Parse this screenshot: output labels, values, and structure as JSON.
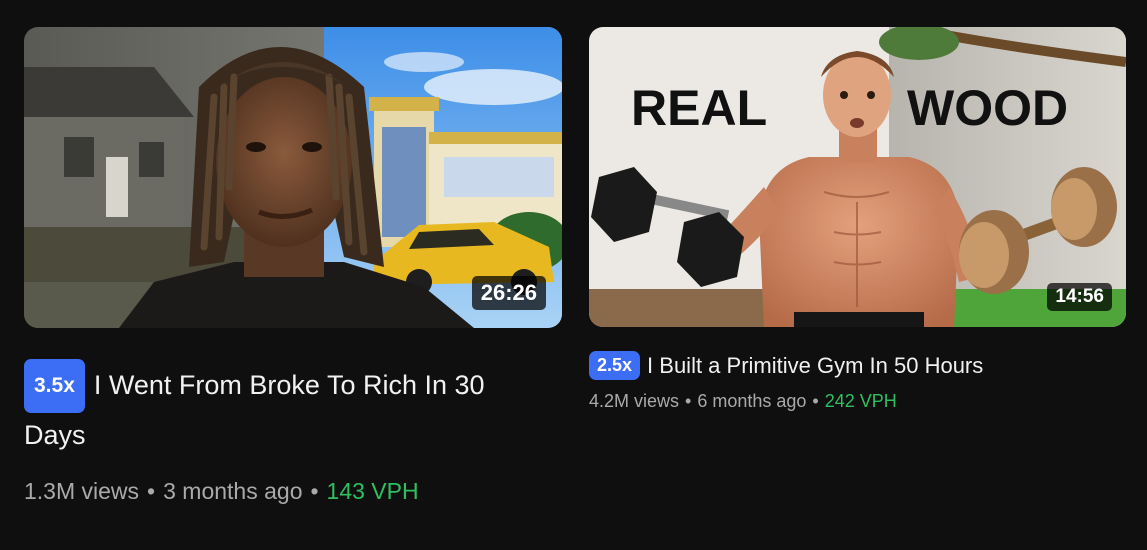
{
  "videos": [
    {
      "duration": "26:26",
      "multiplier": "3.5x",
      "title": "I Went From Broke To Rich In 30 Days",
      "views": "1.3M views",
      "age": "3 months ago",
      "vph": "143 VPH"
    },
    {
      "duration": "14:56",
      "multiplier": "2.5x",
      "title": "I Built a Primitive Gym In 50 Hours",
      "views": "4.2M views",
      "age": "6 months ago",
      "vph": "242 VPH",
      "thumb_text_left": "REAL",
      "thumb_text_right": "WOOD"
    }
  ],
  "colors": {
    "background": "#0f0f0f",
    "badge": "#3b6ef5",
    "vph": "#2fbf60",
    "meta": "#aaaaaa",
    "title": "#f1f1f1"
  },
  "separator": "•"
}
